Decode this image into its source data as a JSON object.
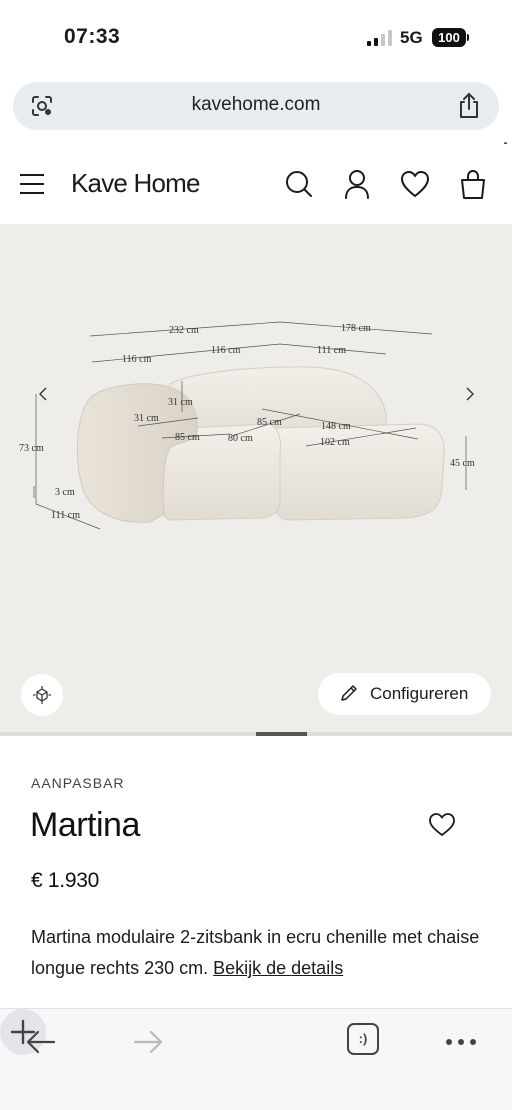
{
  "status_bar": {
    "time": "07:33",
    "network": "5G",
    "battery": "100",
    "signal_bars_active": 2,
    "signal_bars_total": 4
  },
  "browser": {
    "url": "kavehome.com",
    "left_icon": "lens-scan-icon",
    "right_icon": "share-icon"
  },
  "header": {
    "brand": "Kave Home",
    "icons": [
      "menu-icon",
      "search-icon",
      "account-icon",
      "heart-icon",
      "bag-icon"
    ]
  },
  "gallery": {
    "dimensions": {
      "total_width": "232 cm",
      "chaise_total": "178 cm",
      "left_section": "116 cm",
      "mid_section": "116 cm",
      "chaise_section": "111 cm",
      "back_height": "31 cm",
      "arm_width": "31 cm",
      "seat_depth": "85 cm",
      "seat_width": "80 cm",
      "chaise_depth_inner": "85 cm",
      "chaise_length": "148 cm",
      "chaise_width": "102 cm",
      "height": "73 cm",
      "seat_height": "45 cm",
      "leg_height": "3 cm",
      "depth": "111 cm"
    },
    "ar_icon": "3d-view-icon",
    "configure_label": "Configureren",
    "configure_icon": "pencil-icon",
    "progress": 0.5
  },
  "product": {
    "eyebrow": "AANPASBAR",
    "name": "Martina",
    "price": "€ 1.930",
    "description": "Martina modulaire 2-zitsbank in ecru chenille met chaise longue rechts 230 cm.",
    "details_link": "Bekijk de details"
  },
  "toolbar": {
    "icons": [
      "back-icon",
      "forward-icon",
      "new-tab-icon",
      "tabs-icon",
      "more-icon"
    ],
    "tabs_label": ":)"
  },
  "colors": {
    "gallery_bg": "#efedea",
    "address_bar_bg": "#e9ecef",
    "text": "#1b1b1b"
  }
}
